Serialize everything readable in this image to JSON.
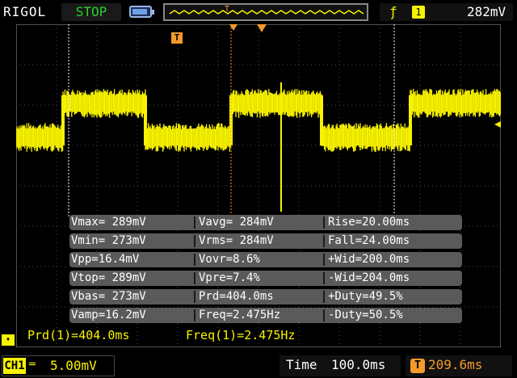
{
  "header": {
    "brand": "RIGOL",
    "run_state": "STOP",
    "trigger_edge_icon": "rising-edge-icon",
    "trigger_source": "1",
    "trigger_level": "282mV",
    "memory_marker": "T"
  },
  "markers": {
    "trigger_T": "T",
    "left_channel": "1"
  },
  "measurements": [
    [
      "Vmax= 289mV",
      "Vavg= 284mV",
      "Rise=20.00ms"
    ],
    [
      "Vmin= 273mV",
      "Vrms= 284mV",
      "Fall=24.00ms"
    ],
    [
      "Vpp=16.4mV",
      "Vovr=8.6%",
      "+Wid=200.0ms"
    ],
    [
      "Vtop= 289mV",
      "Vpre=7.4%",
      "-Wid=204.0ms"
    ],
    [
      "Vbas= 273mV",
      "Prd=404.0ms",
      "+Duty=49.5%"
    ],
    [
      "Vamp=16.2mV",
      "Freq=2.475Hz",
      "-Duty=50.5%"
    ]
  ],
  "bottom": {
    "prd": "Prd(1)=404.0ms",
    "freq": "Freq(1)=2.475Hz"
  },
  "status": {
    "channel": "CH1",
    "coupling_icon": "dc-coupling-icon",
    "scale": "5.00mV",
    "time_label": "Time",
    "time_value": "100.0ms",
    "offset_icon": "T",
    "offset_value": "209.6ms"
  },
  "colors": {
    "channel1": "#f7f200",
    "trigger": "#f39a2a",
    "stop": "#2bd12b",
    "grid": "#6a6a6a"
  }
}
